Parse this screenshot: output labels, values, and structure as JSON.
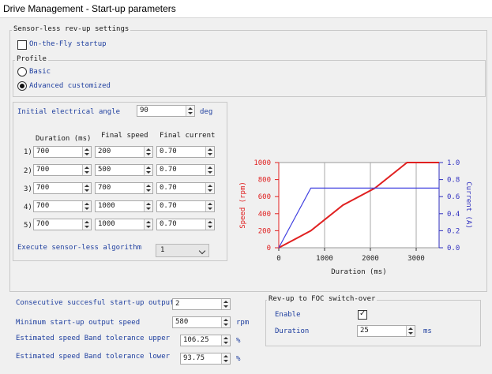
{
  "window": {
    "title": "Drive Management - Start-up parameters"
  },
  "sensorless": {
    "group_title": "Sensor-less rev-up settings",
    "on_the_fly": {
      "label": "On-the-Fly startup",
      "checked": false
    }
  },
  "profile": {
    "title": "Profile",
    "options": [
      {
        "label": "Basic",
        "selected": false
      },
      {
        "label": "Advanced customized",
        "selected": true
      }
    ]
  },
  "initial_angle": {
    "label": "Initial electrical angle",
    "value": "90",
    "unit": "deg"
  },
  "table": {
    "headers": [
      "Duration (ms)",
      "Final speed",
      "Final current"
    ],
    "rows": [
      {
        "index": "1)",
        "duration": "700",
        "speed": "200",
        "current": "0.70"
      },
      {
        "index": "2)",
        "duration": "700",
        "speed": "500",
        "current": "0.70"
      },
      {
        "index": "3)",
        "duration": "700",
        "speed": "700",
        "current": "0.70"
      },
      {
        "index": "4)",
        "duration": "700",
        "speed": "1000",
        "current": "0.70"
      },
      {
        "index": "5)",
        "duration": "700",
        "speed": "1000",
        "current": "0.70"
      }
    ]
  },
  "execute": {
    "label": "Execute sensor-less algorithm",
    "value": "1"
  },
  "chart_data": {
    "type": "line",
    "xlabel": "Duration (ms)",
    "ylabel": "Speed (rpm)",
    "y2label": "Current (A)",
    "xlim": [
      0,
      3500
    ],
    "ylim": [
      0,
      1000
    ],
    "y2lim": [
      0,
      1.0
    ],
    "x_ticks": [
      0,
      1000,
      2000,
      3000
    ],
    "y_ticks": [
      0,
      200,
      400,
      600,
      800,
      1000
    ],
    "y2_ticks": [
      "0.0",
      "0.2",
      "0.4",
      "0.6",
      "0.8",
      "1.0"
    ],
    "grid": "vertical",
    "series": [
      {
        "axis": "left",
        "color": "#e02020",
        "x": [
          0,
          700,
          1400,
          2100,
          2800,
          3500
        ],
        "y": [
          0,
          200,
          500,
          700,
          1000,
          1000
        ]
      },
      {
        "axis": "right",
        "color": "#4040e0",
        "x": [
          0,
          700,
          3500
        ],
        "y": [
          0,
          0.7,
          0.7
        ]
      }
    ]
  },
  "bottom": {
    "consecutive": {
      "label": "Consecutive succesful start-up output",
      "value": "2"
    },
    "min_speed": {
      "label": "Minimum start-up output speed",
      "value": "580",
      "unit": "rpm"
    },
    "tol_upper": {
      "label": "Estimated speed Band tolerance upper",
      "value": "106.25",
      "unit": "%"
    },
    "tol_lower": {
      "label": "Estimated speed Band tolerance lower",
      "value": "93.75",
      "unit": "%"
    }
  },
  "foc": {
    "title": "Rev-up to FOC switch-over",
    "enable": {
      "label": "Enable",
      "checked": true
    },
    "duration": {
      "label": "Duration",
      "value": "25",
      "unit": "ms"
    }
  },
  "colors": {
    "speed_axis": "#e02020",
    "current_axis": "#3030c0",
    "label_blue": "#1f3f9f"
  }
}
